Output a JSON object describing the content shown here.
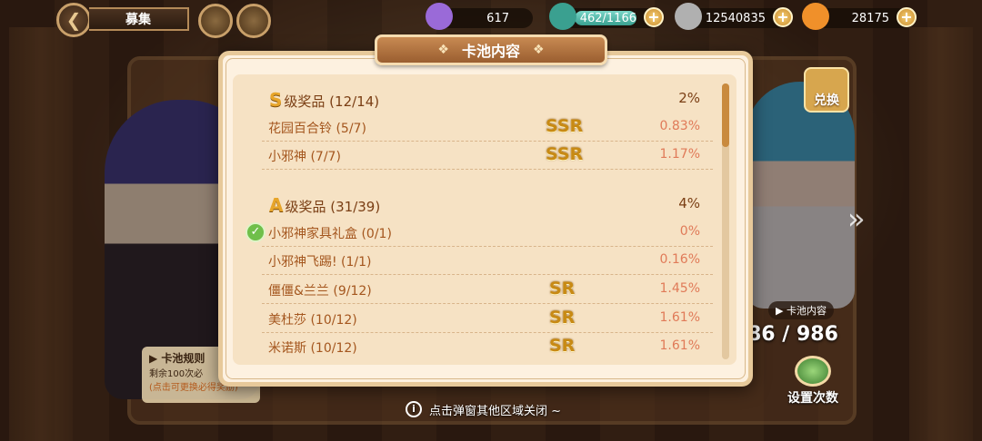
{
  "topbar": {
    "title": "募集",
    "resources": [
      {
        "name": "potion",
        "value": "617",
        "color": "#9a6ad8"
      },
      {
        "name": "stamina",
        "value": "462/1166",
        "color": "#3aa090"
      },
      {
        "name": "coin",
        "value": "12540835",
        "color": "#b0b0b0"
      },
      {
        "name": "carrot",
        "value": "28175",
        "color": "#f0902a"
      }
    ]
  },
  "modal": {
    "title": "卡池内容",
    "sections": [
      {
        "grade": "S",
        "label": "级奖品 (12/14)",
        "rate": "2%",
        "items": [
          {
            "name": "花园百合铃 (5/7)",
            "rarity": "SSR",
            "rate": "0.83%"
          },
          {
            "name": "小邪神 (7/7)",
            "rarity": "SSR",
            "rate": "1.17%"
          }
        ]
      },
      {
        "grade": "A",
        "label": "级奖品 (31/39)",
        "rate": "4%",
        "items": [
          {
            "name": "小邪神家具礼盒 (0/1)",
            "rarity": "",
            "rate": "0%",
            "checked": true
          },
          {
            "name": "小邪神飞踢! (1/1)",
            "rarity": "",
            "rate": "0.16%"
          },
          {
            "name": "僵僵&兰兰 (9/12)",
            "rarity": "SR",
            "rate": "1.45%"
          },
          {
            "name": "美杜莎 (10/12)",
            "rarity": "SR",
            "rate": "1.61%"
          },
          {
            "name": "米诺斯 (10/12)",
            "rarity": "SR",
            "rate": "1.61%"
          }
        ]
      }
    ]
  },
  "background": {
    "exchange_label": "兑换",
    "pool_tag": "卡池内容",
    "pool_count": "86 / 986",
    "settings_label": "设置次数",
    "rules_title": "▶ 卡池规则",
    "rules_line1": "剩余100次必",
    "rules_line2": "(点击可更换必得奖励)"
  },
  "hint": "点击弹窗其他区域关闭 ~",
  "colors": {
    "modal_bg": "#fdf1e0",
    "header_bg": "#b07040",
    "rarity_gold": "#c88a14",
    "rate_color": "#e07a58"
  }
}
